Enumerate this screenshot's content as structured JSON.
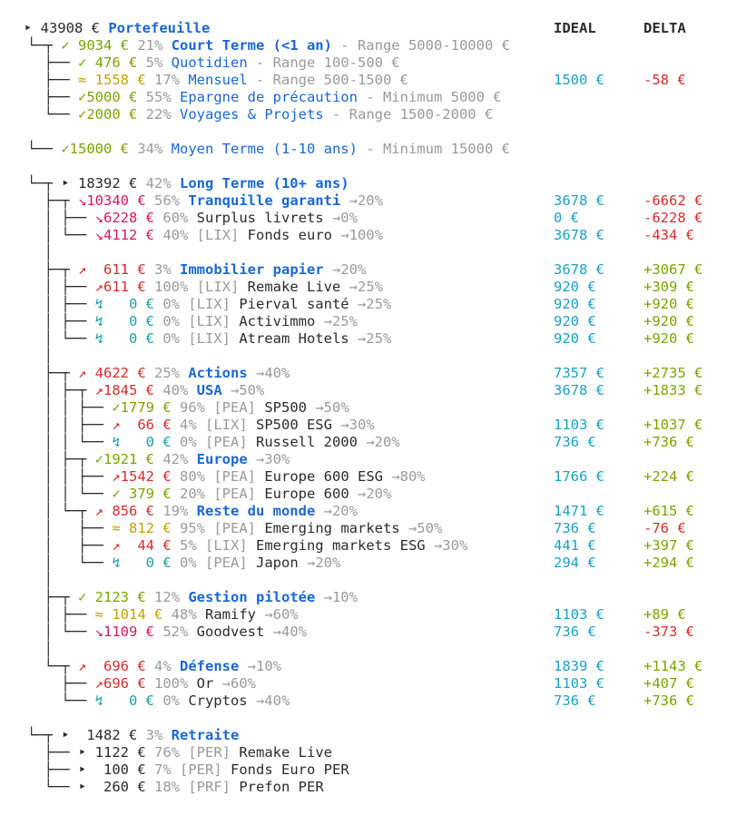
{
  "colors": {
    "blue": "#1a67d6",
    "green": "#7aa400",
    "red": "#d62b2b",
    "pink": "#d4185e",
    "teal": "#1aa0a8",
    "yellow": "#c4a000",
    "cyan": "#1aa0c8",
    "gray": "#9a9a9a"
  },
  "headers": {
    "ideal": "IDEAL",
    "delta": "DELTA"
  },
  "rows": [
    {
      "tree": "‣ ",
      "sym": "",
      "symc": "dark",
      "amt": "43908",
      "pct": "",
      "tag": "",
      "name": "Portefeuille",
      "nameStyle": "blue-bold",
      "suffix": "",
      "ideal": "",
      "delta": "",
      "deltaSign": ""
    },
    {
      "tree": "└─┬ ",
      "sym": "✓ ",
      "symc": "green",
      "amt": "9034",
      "pct": "21%",
      "tag": "",
      "name": "Court Terme (<1 an)",
      "nameStyle": "blue-bold",
      "suffix": " - Range 5000-10000 €",
      "ideal": "",
      "delta": "",
      "deltaSign": ""
    },
    {
      "tree": "  ├── ",
      "sym": "✓ ",
      "symc": "green",
      "amt": "476",
      "pct": "5%",
      "tag": "",
      "name": "Quotidien",
      "nameStyle": "blue",
      "suffix": " - Range 100-500 €",
      "ideal": "",
      "delta": "",
      "deltaSign": ""
    },
    {
      "tree": "  ├── ",
      "sym": "≈ ",
      "symc": "yellow",
      "amt": "1558",
      "pct": "17%",
      "tag": "",
      "name": "Mensuel",
      "nameStyle": "blue",
      "suffix": " - Range 500-1500 €",
      "ideal": "1500 €",
      "delta": "-58 €",
      "deltaSign": "neg"
    },
    {
      "tree": "  ├── ",
      "sym": "✓",
      "symc": "green",
      "amt": "5000",
      "pct": "55%",
      "tag": "",
      "name": "Epargne de précaution",
      "nameStyle": "blue",
      "suffix": " - Minimum 5000 €",
      "ideal": "",
      "delta": "",
      "deltaSign": ""
    },
    {
      "tree": "  └── ",
      "sym": "✓",
      "symc": "green",
      "amt": "2000",
      "pct": "22%",
      "tag": "",
      "name": "Voyages & Projets",
      "nameStyle": "blue",
      "suffix": " - Range 1500-2000 €",
      "ideal": "",
      "delta": "",
      "deltaSign": ""
    },
    {
      "blank": true
    },
    {
      "tree": "└── ",
      "sym": "✓",
      "symc": "green",
      "amt": "15000",
      "pct": "34%",
      "tag": "",
      "name": "Moyen Terme (1-10 ans)",
      "nameStyle": "blue",
      "suffix": " - Minimum 15000 €",
      "ideal": "",
      "delta": "",
      "deltaSign": ""
    },
    {
      "blank": true
    },
    {
      "tree": "└─┬ ",
      "sym": "‣ ",
      "symc": "dark",
      "amt": "18392",
      "pct": "42%",
      "tag": "",
      "name": "Long Terme (10+ ans)",
      "nameStyle": "blue-bold",
      "suffix": "",
      "ideal": "",
      "delta": "",
      "deltaSign": ""
    },
    {
      "tree": "  ├─┬ ",
      "sym": "↘",
      "symc": "pink",
      "amt": "10340",
      "pct": "56%",
      "tag": "",
      "name": "Tranquille garanti",
      "nameStyle": "blue-bold",
      "suffix": " →20%",
      "ideal": "3678 €",
      "delta": "-6662 €",
      "deltaSign": "neg"
    },
    {
      "tree": "  │ ├── ",
      "sym": "↘",
      "symc": "pink",
      "amt": "6228",
      "pct": "60%",
      "tag": "",
      "name": "Surplus livrets",
      "nameStyle": "dark",
      "suffix": " →0%",
      "ideal": "0 €",
      "delta": "-6228 €",
      "deltaSign": "neg"
    },
    {
      "tree": "  │ └── ",
      "sym": "↘",
      "symc": "pink",
      "amt": "4112",
      "pct": "40%",
      "tag": "[LIX]",
      "name": "Fonds euro",
      "nameStyle": "dark",
      "suffix": " →100%",
      "ideal": "3678 €",
      "delta": "-434 €",
      "deltaSign": "neg"
    },
    {
      "tree": "  │",
      "blank": true
    },
    {
      "tree": "  ├─┬ ",
      "sym": "↗  ",
      "symc": "red",
      "amt": "611",
      "pct": "3%",
      "tag": "",
      "name": "Immobilier papier",
      "nameStyle": "blue-bold",
      "suffix": " →20%",
      "ideal": "3678 €",
      "delta": "+3067 €",
      "deltaSign": "pos"
    },
    {
      "tree": "  │ ├── ",
      "sym": "↗",
      "symc": "red",
      "amt": "611",
      "pct": "100%",
      "tag": "[LIX]",
      "name": "Remake Live",
      "nameStyle": "dark",
      "suffix": " →25%",
      "ideal": "920 €",
      "delta": "+309 €",
      "deltaSign": "pos"
    },
    {
      "tree": "  │ ├── ",
      "sym": "↯   ",
      "symc": "teal",
      "amt": "0",
      "pct": "0%",
      "tag": "[LIX]",
      "name": "Pierval santé",
      "nameStyle": "dark",
      "suffix": " →25%",
      "ideal": "920 €",
      "delta": "+920 €",
      "deltaSign": "pos"
    },
    {
      "tree": "  │ ├── ",
      "sym": "↯   ",
      "symc": "teal",
      "amt": "0",
      "pct": "0%",
      "tag": "[LIX]",
      "name": "Activimmo",
      "nameStyle": "dark",
      "suffix": " →25%",
      "ideal": "920 €",
      "delta": "+920 €",
      "deltaSign": "pos"
    },
    {
      "tree": "  │ └── ",
      "sym": "↯   ",
      "symc": "teal",
      "amt": "0",
      "pct": "0%",
      "tag": "[LIX]",
      "name": "Atream Hotels",
      "nameStyle": "dark",
      "suffix": " →25%",
      "ideal": "920 €",
      "delta": "+920 €",
      "deltaSign": "pos"
    },
    {
      "tree": "  │",
      "blank": true
    },
    {
      "tree": "  ├─┬ ",
      "sym": "↗ ",
      "symc": "red",
      "amt": "4622",
      "pct": "25%",
      "tag": "",
      "name": "Actions",
      "nameStyle": "blue-bold",
      "suffix": " →40%",
      "ideal": "7357 €",
      "delta": "+2735 €",
      "deltaSign": "pos"
    },
    {
      "tree": "  │ ├─┬ ",
      "sym": "↗",
      "symc": "red",
      "amt": "1845",
      "pct": "40%",
      "tag": "",
      "name": "USA",
      "nameStyle": "blue-bold",
      "suffix": " →50%",
      "ideal": "3678 €",
      "delta": "+1833 €",
      "deltaSign": "pos"
    },
    {
      "tree": "  │ │ ├── ",
      "sym": "✓",
      "symc": "green",
      "amt": "1779",
      "pct": "96%",
      "tag": "[PEA]",
      "name": "SP500",
      "nameStyle": "dark",
      "suffix": " →50%",
      "ideal": "",
      "delta": "",
      "deltaSign": ""
    },
    {
      "tree": "  │ │ ├── ",
      "sym": "↗  ",
      "symc": "red",
      "amt": "66",
      "pct": "4%",
      "tag": "[LIX]",
      "name": "SP500 ESG",
      "nameStyle": "dark",
      "suffix": " →30%",
      "ideal": "1103 €",
      "delta": "+1037 €",
      "deltaSign": "pos"
    },
    {
      "tree": "  │ │ └── ",
      "sym": "↯   ",
      "symc": "teal",
      "amt": "0",
      "pct": "0%",
      "tag": "[PEA]",
      "name": "Russell 2000",
      "nameStyle": "dark",
      "suffix": " →20%",
      "ideal": "736 €",
      "delta": "+736 €",
      "deltaSign": "pos"
    },
    {
      "tree": "  │ ├─┬ ",
      "sym": "✓",
      "symc": "green",
      "amt": "1921",
      "pct": "42%",
      "tag": "",
      "name": "Europe",
      "nameStyle": "blue-bold",
      "suffix": " →30%",
      "ideal": "",
      "delta": "",
      "deltaSign": ""
    },
    {
      "tree": "  │ │ ├── ",
      "sym": "↗",
      "symc": "red",
      "amt": "1542",
      "pct": "80%",
      "tag": "[PEA]",
      "name": "Europe 600 ESG",
      "nameStyle": "dark",
      "suffix": " →80%",
      "ideal": "1766 €",
      "delta": "+224 €",
      "deltaSign": "pos"
    },
    {
      "tree": "  │ │ └── ",
      "sym": "✓ ",
      "symc": "green",
      "amt": "379",
      "pct": "20%",
      "tag": "[PEA]",
      "name": "Europe 600",
      "nameStyle": "dark",
      "suffix": " →20%",
      "ideal": "",
      "delta": "",
      "deltaSign": ""
    },
    {
      "tree": "  │ └─┬ ",
      "sym": "↗ ",
      "symc": "red",
      "amt": "856",
      "pct": "19%",
      "tag": "",
      "name": "Reste du monde",
      "nameStyle": "blue-bold",
      "suffix": " →20%",
      "ideal": "1471 €",
      "delta": "+615 €",
      "deltaSign": "pos"
    },
    {
      "tree": "  │   ├── ",
      "sym": "≈ ",
      "symc": "yellow",
      "amt": "812",
      "pct": "95%",
      "tag": "[PEA]",
      "name": "Emerging markets",
      "nameStyle": "dark",
      "suffix": " →50%",
      "ideal": "736 €",
      "delta": "-76 €",
      "deltaSign": "neg"
    },
    {
      "tree": "  │   ├── ",
      "sym": "↗  ",
      "symc": "red",
      "amt": "44",
      "pct": "5%",
      "tag": "[LIX]",
      "name": "Emerging markets ESG",
      "nameStyle": "dark",
      "suffix": " →30%",
      "ideal": "441 €",
      "delta": "+397 €",
      "deltaSign": "pos"
    },
    {
      "tree": "  │   └── ",
      "sym": "↯   ",
      "symc": "teal",
      "amt": "0",
      "pct": "0%",
      "tag": "[PEA]",
      "name": "Japon",
      "nameStyle": "dark",
      "suffix": " →20%",
      "ideal": "294 €",
      "delta": "+294 €",
      "deltaSign": "pos"
    },
    {
      "tree": "  │",
      "blank": true
    },
    {
      "tree": "  ├─┬ ",
      "sym": "✓ ",
      "symc": "green",
      "amt": "2123",
      "pct": "12%",
      "tag": "",
      "name": "Gestion pilotée",
      "nameStyle": "blue-bold",
      "suffix": " →10%",
      "ideal": "",
      "delta": "",
      "deltaSign": ""
    },
    {
      "tree": "  │ ├── ",
      "sym": "≈ ",
      "symc": "yellow",
      "amt": "1014",
      "pct": "48%",
      "tag": "",
      "name": "Ramify",
      "nameStyle": "dark",
      "suffix": " →60%",
      "ideal": "1103 €",
      "delta": "+89 €",
      "deltaSign": "pos"
    },
    {
      "tree": "  │ └── ",
      "sym": "↘",
      "symc": "pink",
      "amt": "1109",
      "pct": "52%",
      "tag": "",
      "name": "Goodvest",
      "nameStyle": "dark",
      "suffix": " →40%",
      "ideal": "736 €",
      "delta": "-373 €",
      "deltaSign": "neg"
    },
    {
      "tree": "  │",
      "blank": true
    },
    {
      "tree": "  └─┬ ",
      "sym": "↗  ",
      "symc": "red",
      "amt": "696",
      "pct": "4%",
      "tag": "",
      "name": "Défense",
      "nameStyle": "blue-bold",
      "suffix": " →10%",
      "ideal": "1839 €",
      "delta": "+1143 €",
      "deltaSign": "pos"
    },
    {
      "tree": "    ├── ",
      "sym": "↗",
      "symc": "red",
      "amt": "696",
      "pct": "100%",
      "tag": "",
      "name": "Or",
      "nameStyle": "dark",
      "suffix": " →60%",
      "ideal": "1103 €",
      "delta": "+407 €",
      "deltaSign": "pos"
    },
    {
      "tree": "    └── ",
      "sym": "↯   ",
      "symc": "teal",
      "amt": "0",
      "pct": "0%",
      "tag": "",
      "name": "Cryptos",
      "nameStyle": "dark",
      "suffix": " →40%",
      "ideal": "736 €",
      "delta": "+736 €",
      "deltaSign": "pos"
    },
    {
      "blank": true
    },
    {
      "tree": "└─┬ ",
      "sym": "‣  ",
      "symc": "dark",
      "amt": "1482",
      "pct": "3%",
      "tag": "",
      "name": "Retraite",
      "nameStyle": "blue-bold",
      "suffix": "",
      "ideal": "",
      "delta": "",
      "deltaSign": ""
    },
    {
      "tree": "  ├── ",
      "sym": "‣ ",
      "symc": "dark",
      "amt": "1122",
      "pct": "76%",
      "tag": "[PER]",
      "name": "Remake Live",
      "nameStyle": "dark",
      "suffix": "",
      "ideal": "",
      "delta": "",
      "deltaSign": ""
    },
    {
      "tree": "  ├── ",
      "sym": "‣  ",
      "symc": "dark",
      "amt": "100",
      "pct": "7%",
      "tag": "[PER]",
      "name": "Fonds Euro PER",
      "nameStyle": "dark",
      "suffix": "",
      "ideal": "",
      "delta": "",
      "deltaSign": ""
    },
    {
      "tree": "  └── ",
      "sym": "‣  ",
      "symc": "dark",
      "amt": "260",
      "pct": "18%",
      "tag": "[PRF]",
      "name": "Prefon PER",
      "nameStyle": "dark",
      "suffix": "",
      "ideal": "",
      "delta": "",
      "deltaSign": ""
    }
  ]
}
